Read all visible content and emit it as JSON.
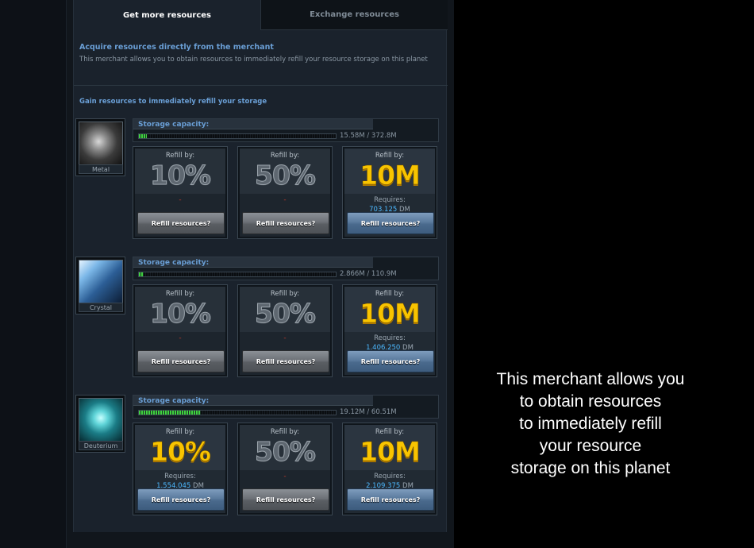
{
  "tabs": [
    {
      "label": "Get more resources",
      "active": true
    },
    {
      "label": "Exchange resources",
      "active": false
    }
  ],
  "header": {
    "title": "Acquire resources directly from the merchant",
    "description": "This merchant allows you to obtain resources to immediately refill your resource storage on this planet"
  },
  "section_title": "Gain resources to immediately refill your storage",
  "resources": [
    {
      "name": "Metal",
      "storage_label": "Storage capacity:",
      "storage_value": "15.58M / 372.8M",
      "fill_fraction": 0.042,
      "options": [
        {
          "label": "Refill by:",
          "amount": "10%",
          "available": false,
          "placeholder": "-",
          "button": "Refill resources?"
        },
        {
          "label": "Refill by:",
          "amount": "50%",
          "available": false,
          "placeholder": "-",
          "button": "Refill resources?"
        },
        {
          "label": "Refill by:",
          "amount": "10M",
          "available": true,
          "requires_label": "Requires:",
          "cost": "703.125",
          "unit": "DM",
          "button": "Refill resources?"
        }
      ]
    },
    {
      "name": "Crystal",
      "storage_label": "Storage capacity:",
      "storage_value": "2.866M / 110.9M",
      "fill_fraction": 0.026,
      "options": [
        {
          "label": "Refill by:",
          "amount": "10%",
          "available": false,
          "placeholder": "-",
          "button": "Refill resources?"
        },
        {
          "label": "Refill by:",
          "amount": "50%",
          "available": false,
          "placeholder": "-",
          "button": "Refill resources?"
        },
        {
          "label": "Refill by:",
          "amount": "10M",
          "available": true,
          "requires_label": "Requires:",
          "cost": "1.406.250",
          "unit": "DM",
          "button": "Refill resources?"
        }
      ]
    },
    {
      "name": "Deuterium",
      "storage_label": "Storage capacity:",
      "storage_value": "19.12M / 60.51M",
      "fill_fraction": 0.316,
      "options": [
        {
          "label": "Refill by:",
          "amount": "10%",
          "available": true,
          "requires_label": "Requires:",
          "cost": "1.554.045",
          "unit": "DM",
          "button": "Refill resources?"
        },
        {
          "label": "Refill by:",
          "amount": "50%",
          "available": false,
          "placeholder": "-",
          "button": "Refill resources?"
        },
        {
          "label": "Refill by:",
          "amount": "10M",
          "available": true,
          "requires_label": "Requires:",
          "cost": "2.109.375",
          "unit": "DM",
          "button": "Refill resources?"
        }
      ]
    }
  ],
  "caption_lines": [
    "This merchant allows you",
    "to obtain resources",
    "to immediately refill",
    "your resource",
    "storage on this planet"
  ],
  "colors": {
    "accent_blue": "#6a9fd6",
    "gold": "#f8c400",
    "cost_blue": "#4cb8ff",
    "storage_green": "#3fd23f"
  },
  "icons": {
    "Metal": "metal-ore-icon",
    "Crystal": "crystal-icon",
    "Deuterium": "deuterium-icon"
  }
}
